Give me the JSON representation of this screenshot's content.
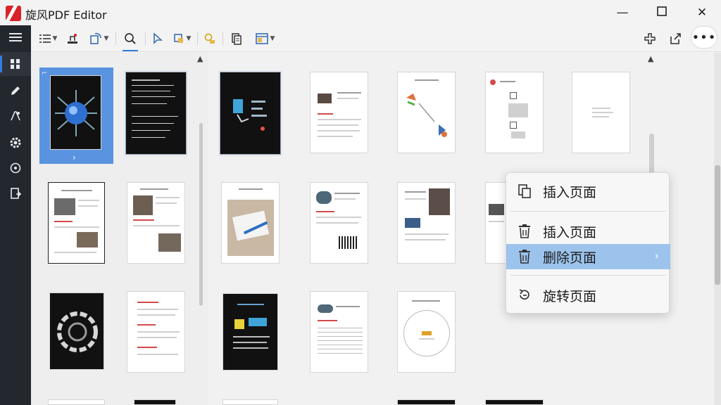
{
  "window": {
    "title": "旋风PDF Editor",
    "min_glyph": "—",
    "max_glyph": "☐",
    "close_glyph": "✕"
  },
  "toolbar": {
    "more_glyph": "•••"
  },
  "context_menu": {
    "items": [
      {
        "label": "插入页面",
        "icon": "insert-page-icon"
      },
      {
        "label": "插入页面",
        "icon": "trash-icon"
      },
      {
        "label": "删除页面",
        "icon": "trash-icon",
        "highlighted": true,
        "submenu_glyph": "›"
      },
      {
        "label": "旋转页面",
        "icon": "rotate-icon"
      }
    ]
  },
  "colors": {
    "accent": "#2f7de1",
    "rail_bg": "#23272e",
    "menu_highlight": "#9cc3ec",
    "selection": "#5a93df"
  }
}
